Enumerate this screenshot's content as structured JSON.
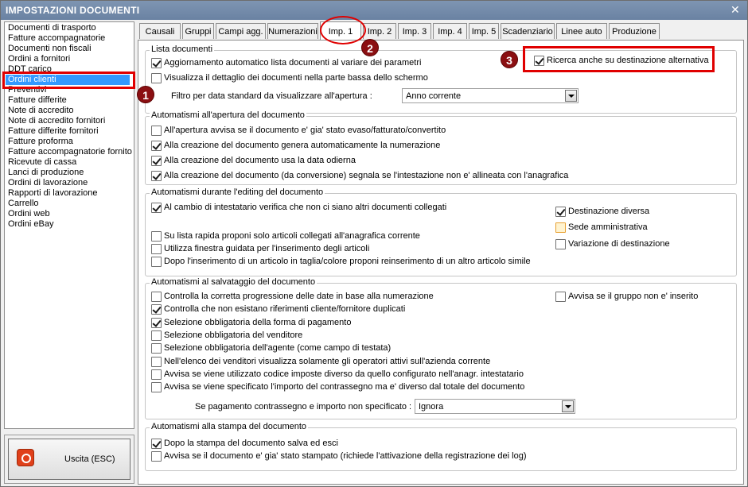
{
  "window": {
    "title": "IMPOSTAZIONI DOCUMENTI",
    "close": "✕"
  },
  "sidebar": {
    "items": [
      {
        "label": "Documenti di trasporto"
      },
      {
        "label": "Fatture accompagnatorie"
      },
      {
        "label": "Documenti non fiscali"
      },
      {
        "label": "Ordini a fornitori"
      },
      {
        "label": "DDT carico"
      },
      {
        "label": "Ordini clienti",
        "selected": true
      },
      {
        "label": "Preventivi"
      },
      {
        "label": "Fatture differite"
      },
      {
        "label": "Note di accredito"
      },
      {
        "label": "Note di accredito fornitori"
      },
      {
        "label": "Fatture differite fornitori"
      },
      {
        "label": "Fatture proforma"
      },
      {
        "label": "Fatture accompagnatorie fornito"
      },
      {
        "label": "Ricevute di cassa"
      },
      {
        "label": "Lanci di produzione"
      },
      {
        "label": "Ordini di lavorazione"
      },
      {
        "label": "Rapporti di lavorazione"
      },
      {
        "label": "Carrello"
      },
      {
        "label": "Ordini web"
      },
      {
        "label": "Ordini eBay"
      }
    ],
    "exit_label": "Uscita (ESC)",
    "exit_icon": "power-icon"
  },
  "tabs": [
    {
      "label": "Causali"
    },
    {
      "label": "Gruppi"
    },
    {
      "label": "Campi agg."
    },
    {
      "label": "Numerazioni"
    },
    {
      "label": "Imp. 1",
      "active": true
    },
    {
      "label": "Imp. 2"
    },
    {
      "label": "Imp. 3"
    },
    {
      "label": "Imp. 4"
    },
    {
      "label": "Imp. 5"
    },
    {
      "label": "Scadenziario"
    },
    {
      "label": "Linee auto"
    },
    {
      "label": "Produzione"
    }
  ],
  "annotations": {
    "badge1": "1",
    "badge2": "2",
    "badge3": "3",
    "highlight_color": "#e00000",
    "badge_color": "#8b0f12"
  },
  "lista_documenti": {
    "title": "Lista documenti",
    "aggiornamento": {
      "label": "Aggiornamento automatico lista documenti al variare dei parametri",
      "checked": true
    },
    "dettaglio": {
      "label": "Visualizza il dettaglio dei documenti nella parte bassa dello schermo",
      "checked": false
    },
    "ricerca_alt": {
      "label": "Ricerca anche su destinazione alternativa",
      "checked": true
    },
    "filtro_label": "Filtro per data standard da visualizzare all'apertura :",
    "filtro_value": "Anno corrente"
  },
  "apertura": {
    "title": "Automatismi all'apertura del documento",
    "items": [
      {
        "label": "All'apertura avvisa se il documento e' gia' stato evaso/fatturato/convertito",
        "checked": false
      },
      {
        "label": "Alla creazione del documento genera automaticamente la numerazione",
        "checked": true
      },
      {
        "label": "Alla creazione del documento usa la data odierna",
        "checked": true
      },
      {
        "label": "Alla creazione del documento (da conversione) segnala se l'intestazione non e' allineata con l'anagrafica",
        "checked": true
      }
    ]
  },
  "editing": {
    "title": "Automatismi durante l'editing del documento",
    "cambio": {
      "label": "Al cambio di intestatario verifica che non ci siano altri documenti collegati",
      "checked": true
    },
    "destinazione_diversa": {
      "label": "Destinazione diversa",
      "checked": true
    },
    "sede_amministrativa": {
      "label": "Sede amministrativa",
      "checked": false
    },
    "variazione": {
      "label": "Variazione di destinazione",
      "checked": false
    },
    "items": [
      {
        "label": "Su lista rapida proponi solo articoli collegati all'anagrafica corrente",
        "checked": false
      },
      {
        "label": "Utilizza finestra guidata per l'inserimento degli articoli",
        "checked": false
      },
      {
        "label": "Dopo l'inserimento di un articolo in taglia/colore proponi reinserimento di un altro articolo simile",
        "checked": false
      }
    ]
  },
  "salvataggio": {
    "title": "Automatismi al salvataggio del documento",
    "gruppo": {
      "label": "Avvisa se il gruppo non e' inserito",
      "checked": false
    },
    "items": [
      {
        "label": "Controlla la corretta progressione delle date in base alla numerazione",
        "checked": false
      },
      {
        "label": "Controlla che non esistano riferimenti cliente/fornitore duplicati",
        "checked": true
      },
      {
        "label": "Selezione obbligatoria della forma di pagamento",
        "checked": true
      },
      {
        "label": "Selezione obbligatoria del venditore",
        "checked": false
      },
      {
        "label": "Selezione obbligatoria dell'agente (come campo di testata)",
        "checked": false
      },
      {
        "label": "Nell'elenco dei venditori visualizza solamente gli operatori attivi sull'azienda corrente",
        "checked": false
      },
      {
        "label": "Avvisa se viene utilizzato codice imposte diverso da quello configurato nell'anagr. intestatario",
        "checked": false
      },
      {
        "label": "Avvisa se viene specificato l'importo del contrassegno ma e' diverso dal totale del documento",
        "checked": false
      }
    ],
    "contrassegno_label": "Se pagamento contrassegno e importo non specificato :",
    "contrassegno_value": "Ignora"
  },
  "stampa": {
    "title": "Automatismi alla stampa del documento",
    "items": [
      {
        "label": "Dopo la stampa del documento salva ed esci",
        "checked": true
      },
      {
        "label": "Avvisa se il documento e' gia' stato stampato (richiede l'attivazione della registrazione dei log)",
        "checked": false
      }
    ]
  }
}
